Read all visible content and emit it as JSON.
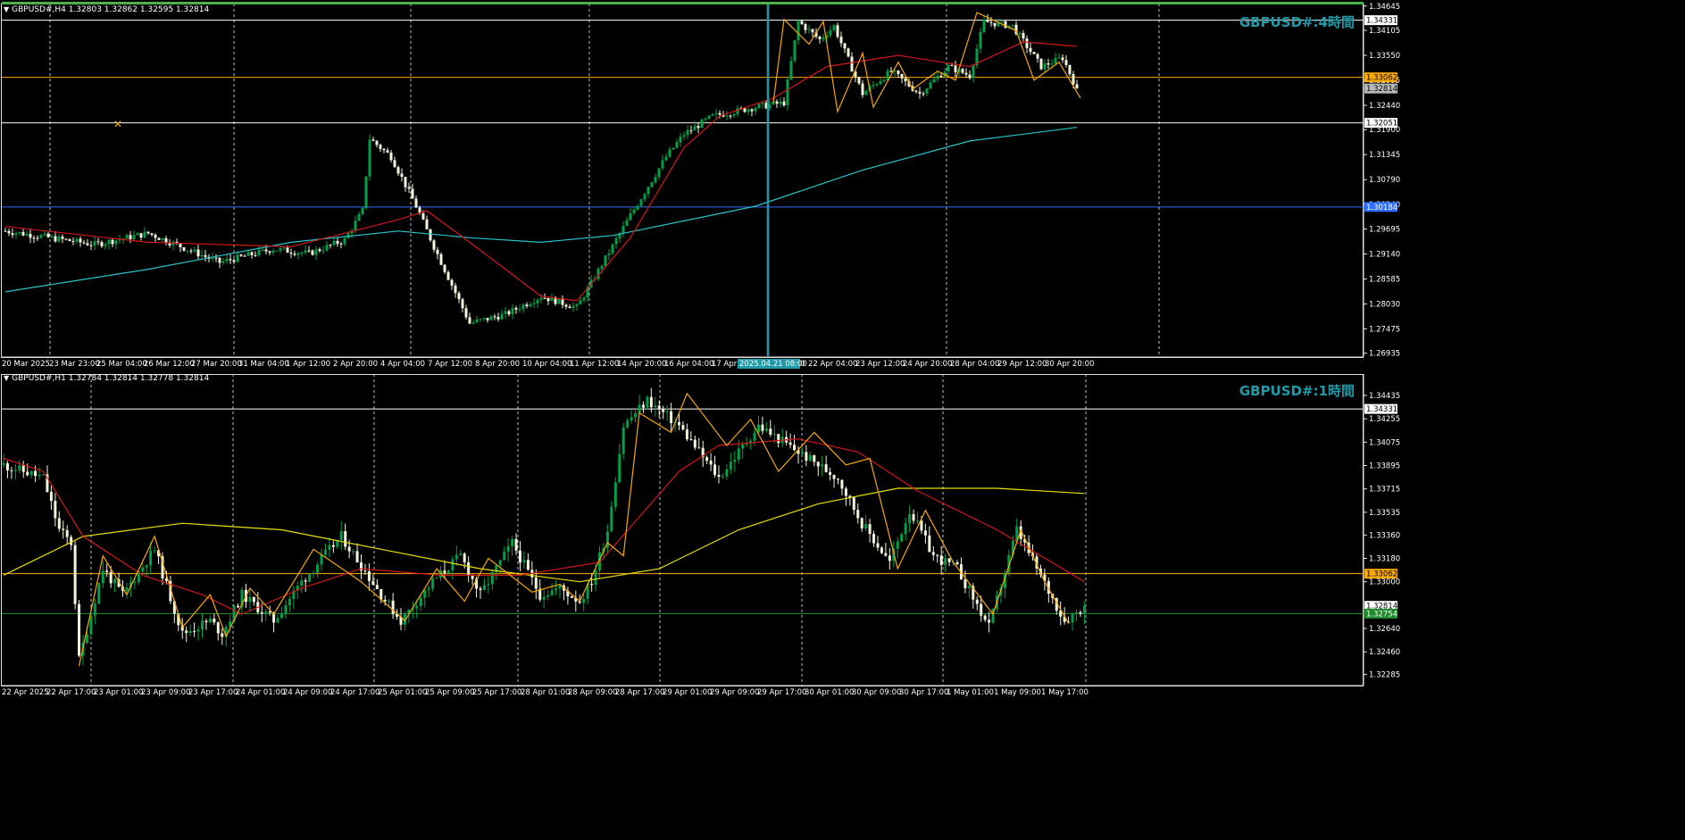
{
  "colors": {
    "background": "#000000",
    "bull": "#00a04a",
    "bear": "#f5f5dc",
    "grid": "#c0c0c0",
    "ma_fast": "#d01818",
    "ma_slow_h4": "#27c4c8",
    "ma_slow_h1": "#e8e000",
    "zigzag": "#f7a800",
    "level_orange": "#f7a800",
    "level_white": "#ffffff",
    "level_blue": "#2f6fff",
    "level_green": "#1e8a2a",
    "watermark": "#1f9aa8",
    "axis_text": "#ffffff"
  },
  "top": {
    "header": "GBPUSD#,H4  1.32803 1.32862 1.32595 1.32814",
    "watermark": "GBPUSD#:4時間",
    "y_ticks": [
      "1.34645",
      "1.34105",
      "1.33550",
      "1.32995",
      "1.32440",
      "1.31900",
      "1.31345",
      "1.30790",
      "1.30240",
      "1.29695",
      "1.29140",
      "1.28585",
      "1.28030",
      "1.27475",
      "1.26935"
    ],
    "price_labels": [
      "1.34331",
      "1.33062",
      "1.32814",
      "1.32051",
      "1.30184"
    ],
    "x_labels": [
      "20 Mar 2025",
      "23 Mar 23:00",
      "25 Mar 04:00",
      "26 Mar 12:00",
      "27 Mar 20:00",
      "31 Mar 04:00",
      "1 Apr 12:00",
      "2 Apr 20:00",
      "4 Apr 04:00",
      "7 Apr 12:00",
      "8 Apr 20:00",
      "10 Apr 04:00",
      "11 Apr 12:00",
      "14 Apr 20:00",
      "16 Apr 04:00",
      "17 Apr",
      "2025.04.21 08:00",
      "0",
      "22 Apr 04:00",
      "23 Apr 12:00",
      "24 Apr 20:00",
      "28 Apr 04:00",
      "29 Apr 12:00",
      "30 Apr 20:00"
    ],
    "chart_data": {
      "type": "candlestick",
      "symbol": "GBPUSD#",
      "timeframe": "H4",
      "ylim": [
        1.2685,
        1.347
      ],
      "ohlc_last": {
        "open": 1.32803,
        "high": 1.32862,
        "low": 1.32595,
        "close": 1.32814
      },
      "keypoints": [
        [
          0,
          1.2965
        ],
        [
          25,
          1.2935
        ],
        [
          40,
          1.296
        ],
        [
          60,
          1.2895
        ],
        [
          75,
          1.2925
        ],
        [
          85,
          1.2915
        ],
        [
          95,
          1.2945
        ],
        [
          100,
          1.301
        ],
        [
          102,
          1.317
        ],
        [
          108,
          1.313
        ],
        [
          115,
          1.302
        ],
        [
          120,
          1.293
        ],
        [
          130,
          1.276
        ],
        [
          140,
          1.278
        ],
        [
          150,
          1.282
        ],
        [
          160,
          1.2795
        ],
        [
          175,
          1.3
        ],
        [
          185,
          1.313
        ],
        [
          190,
          1.318
        ],
        [
          198,
          1.322
        ],
        [
          210,
          1.324
        ],
        [
          218,
          1.325
        ],
        [
          222,
          1.343
        ],
        [
          228,
          1.339
        ],
        [
          232,
          1.342
        ],
        [
          240,
          1.327
        ],
        [
          248,
          1.332
        ],
        [
          256,
          1.327
        ],
        [
          264,
          1.333
        ],
        [
          270,
          1.331
        ],
        [
          274,
          1.343
        ],
        [
          282,
          1.342
        ],
        [
          290,
          1.333
        ],
        [
          296,
          1.335
        ],
        [
          300,
          1.3281
        ]
      ],
      "ma_fast": [
        [
          0,
          1.2975
        ],
        [
          40,
          1.294
        ],
        [
          80,
          1.293
        ],
        [
          110,
          1.299
        ],
        [
          118,
          1.301
        ],
        [
          130,
          1.294
        ],
        [
          150,
          1.282
        ],
        [
          160,
          1.281
        ],
        [
          175,
          1.295
        ],
        [
          190,
          1.315
        ],
        [
          200,
          1.322
        ],
        [
          215,
          1.326
        ],
        [
          230,
          1.333
        ],
        [
          250,
          1.3355
        ],
        [
          270,
          1.333
        ],
        [
          285,
          1.3385
        ],
        [
          300,
          1.3375
        ]
      ],
      "ma_slow": [
        [
          0,
          1.283
        ],
        [
          40,
          1.288
        ],
        [
          80,
          1.294
        ],
        [
          110,
          1.2965
        ],
        [
          130,
          1.295
        ],
        [
          150,
          1.294
        ],
        [
          170,
          1.2955
        ],
        [
          210,
          1.302
        ],
        [
          240,
          1.31
        ],
        [
          270,
          1.3165
        ],
        [
          300,
          1.3195
        ]
      ],
      "zigzag": [
        [
          215,
          1.325
        ],
        [
          218,
          1.3435
        ],
        [
          225,
          1.338
        ],
        [
          229,
          1.343
        ],
        [
          233,
          1.323
        ],
        [
          240,
          1.336
        ],
        [
          243,
          1.324
        ],
        [
          250,
          1.334
        ],
        [
          254,
          1.328
        ],
        [
          261,
          1.332
        ],
        [
          266,
          1.33
        ],
        [
          272,
          1.345
        ],
        [
          283,
          1.341
        ],
        [
          288,
          1.33
        ],
        [
          295,
          1.334
        ],
        [
          301,
          1.326
        ]
      ],
      "levels": [
        1.34331,
        1.33062,
        1.32051,
        1.30184
      ]
    }
  },
  "bottom": {
    "header": "GBPUSD#,H1  1.32784 1.32814 1.32778 1.32814",
    "watermark": "GBPUSD#:1時間",
    "y_ticks": [
      "1.34435",
      "1.34255",
      "1.34075",
      "1.33895",
      "1.33715",
      "1.33535",
      "1.33360",
      "1.33180",
      "1.33000",
      "1.32640",
      "1.32460",
      "1.32285"
    ],
    "price_labels": [
      "1.34331",
      "1.33062",
      "1.32814",
      "1.32754"
    ],
    "x_labels": [
      "22 Apr 2025",
      "22 Apr 17:00",
      "23 Apr 01:00",
      "23 Apr 09:00",
      "23 Apr 17:00",
      "24 Apr 01:00",
      "24 Apr 09:00",
      "24 Apr 17:00",
      "25 Apr 01:00",
      "25 Apr 09:00",
      "25 Apr 17:00",
      "28 Apr 01:00",
      "28 Apr 09:00",
      "28 Apr 17:00",
      "29 Apr 01:00",
      "29 Apr 09:00",
      "29 Apr 17:00",
      "30 Apr 01:00",
      "30 Apr 09:00",
      "30 Apr 17:00",
      "1 May 01:00",
      "1 May 09:00",
      "1 May 17:00"
    ],
    "chart_data": {
      "type": "candlestick",
      "symbol": "GBPUSD#",
      "timeframe": "H1",
      "ylim": [
        1.322,
        1.346
      ],
      "ohlc_last": {
        "open": 1.32784,
        "high": 1.32814,
        "low": 1.32778,
        "close": 1.32814
      },
      "keypoints": [
        [
          0,
          1.339
        ],
        [
          10,
          1.338
        ],
        [
          14,
          1.334
        ],
        [
          17,
          1.333
        ],
        [
          19,
          1.324
        ],
        [
          25,
          1.331
        ],
        [
          30,
          1.329
        ],
        [
          38,
          1.3325
        ],
        [
          45,
          1.326
        ],
        [
          52,
          1.327
        ],
        [
          55,
          1.326
        ],
        [
          60,
          1.329
        ],
        [
          68,
          1.327
        ],
        [
          75,
          1.33
        ],
        [
          85,
          1.3335
        ],
        [
          95,
          1.329
        ],
        [
          100,
          1.327
        ],
        [
          108,
          1.33
        ],
        [
          115,
          1.332
        ],
        [
          120,
          1.329
        ],
        [
          128,
          1.333
        ],
        [
          135,
          1.329
        ],
        [
          140,
          1.3295
        ],
        [
          145,
          1.3285
        ],
        [
          148,
          1.33
        ],
        [
          152,
          1.334
        ],
        [
          156,
          1.342
        ],
        [
          162,
          1.344
        ],
        [
          170,
          1.342
        ],
        [
          180,
          1.338
        ],
        [
          190,
          1.342
        ],
        [
          200,
          1.34
        ],
        [
          210,
          1.338
        ],
        [
          216,
          1.3345
        ],
        [
          223,
          1.3315
        ],
        [
          228,
          1.3355
        ],
        [
          234,
          1.332
        ],
        [
          240,
          1.331
        ],
        [
          248,
          1.3265
        ],
        [
          255,
          1.334
        ],
        [
          260,
          1.331
        ],
        [
          267,
          1.327
        ],
        [
          272,
          1.3281
        ]
      ],
      "ma_fast": [
        [
          0,
          1.3395
        ],
        [
          10,
          1.3385
        ],
        [
          20,
          1.3335
        ],
        [
          35,
          1.3305
        ],
        [
          50,
          1.329
        ],
        [
          60,
          1.3275
        ],
        [
          75,
          1.3295
        ],
        [
          90,
          1.331
        ],
        [
          110,
          1.3305
        ],
        [
          130,
          1.3305
        ],
        [
          150,
          1.3315
        ],
        [
          160,
          1.335
        ],
        [
          170,
          1.3385
        ],
        [
          180,
          1.3405
        ],
        [
          200,
          1.341
        ],
        [
          215,
          1.34
        ],
        [
          230,
          1.337
        ],
        [
          250,
          1.334
        ],
        [
          272,
          1.33
        ]
      ],
      "ma_slow": [
        [
          0,
          1.3305
        ],
        [
          20,
          1.3335
        ],
        [
          45,
          1.3345
        ],
        [
          70,
          1.334
        ],
        [
          95,
          1.3325
        ],
        [
          120,
          1.331
        ],
        [
          145,
          1.33
        ],
        [
          165,
          1.331
        ],
        [
          185,
          1.334
        ],
        [
          205,
          1.336
        ],
        [
          225,
          1.3372
        ],
        [
          250,
          1.3372
        ],
        [
          272,
          1.3368
        ]
      ],
      "zigzag": [
        [
          19,
          1.3235
        ],
        [
          25,
          1.332
        ],
        [
          31,
          1.329
        ],
        [
          38,
          1.3335
        ],
        [
          45,
          1.3265
        ],
        [
          52,
          1.329
        ],
        [
          56,
          1.3258
        ],
        [
          62,
          1.3295
        ],
        [
          68,
          1.3275
        ],
        [
          78,
          1.3325
        ],
        [
          90,
          1.33
        ],
        [
          101,
          1.327
        ],
        [
          109,
          1.331
        ],
        [
          116,
          1.3285
        ],
        [
          122,
          1.3318
        ],
        [
          133,
          1.3292
        ],
        [
          140,
          1.3298
        ],
        [
          145,
          1.3285
        ],
        [
          152,
          1.333
        ],
        [
          156,
          1.332
        ],
        [
          160,
          1.343
        ],
        [
          168,
          1.3415
        ],
        [
          172,
          1.3445
        ],
        [
          182,
          1.3405
        ],
        [
          188,
          1.3425
        ],
        [
          195,
          1.3385
        ],
        [
          204,
          1.3415
        ],
        [
          212,
          1.339
        ],
        [
          218,
          1.3395
        ],
        [
          225,
          1.331
        ],
        [
          232,
          1.3355
        ],
        [
          239,
          1.3315
        ],
        [
          249,
          1.3275
        ],
        [
          256,
          1.334
        ],
        [
          262,
          1.33
        ],
        [
          268,
          1.3268
        ]
      ],
      "levels": [
        1.34331,
        1.33062,
        1.32754
      ]
    }
  }
}
